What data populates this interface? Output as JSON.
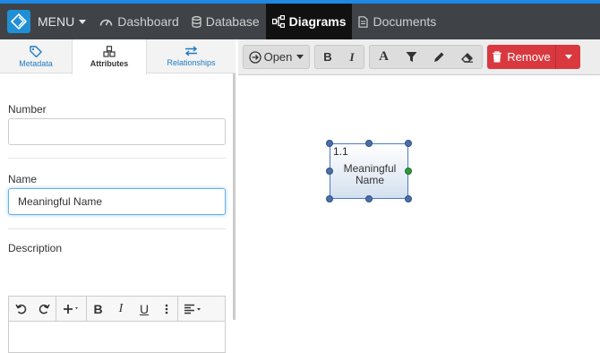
{
  "colors": {
    "top_strip": "#1e88e5",
    "navbar": "#3f4347",
    "active_nav": "#111111",
    "tab_link": "#1e7bc3",
    "remove": "#d9383f",
    "node_border": "#4a79c8",
    "handle": "#4a6fa8",
    "handle_connect": "#2e9a3b"
  },
  "navbar": {
    "logo_icon": "diamond-logo-icon",
    "menu_label": "MENU",
    "items": [
      {
        "label": "Dashboard",
        "icon": "dashboard-icon"
      },
      {
        "label": "Database",
        "icon": "database-icon"
      },
      {
        "label": "Diagrams",
        "icon": "diagram-icon",
        "active": true
      },
      {
        "label": "Documents",
        "icon": "document-icon"
      }
    ]
  },
  "left_panel": {
    "tabs": [
      {
        "label": "Metadata",
        "icon": "tag-icon"
      },
      {
        "label": "Attributes",
        "icon": "cubes-icon",
        "active": true
      },
      {
        "label": "Relationships",
        "icon": "exchange-icon"
      }
    ],
    "fields": {
      "number": {
        "label": "Number",
        "value": ""
      },
      "name": {
        "label": "Name",
        "value": "Meaningful Name"
      },
      "description": {
        "label": "Description",
        "value": ""
      }
    },
    "editor_toolbar": [
      "undo",
      "redo",
      "insert",
      "bold",
      "italic",
      "underline",
      "more",
      "align"
    ]
  },
  "diagram": {
    "toolbar": {
      "open_label": "Open",
      "remove_label": "Remove"
    },
    "node": {
      "id": "1.1",
      "line1": "Meaningful",
      "line2": "Name"
    }
  }
}
